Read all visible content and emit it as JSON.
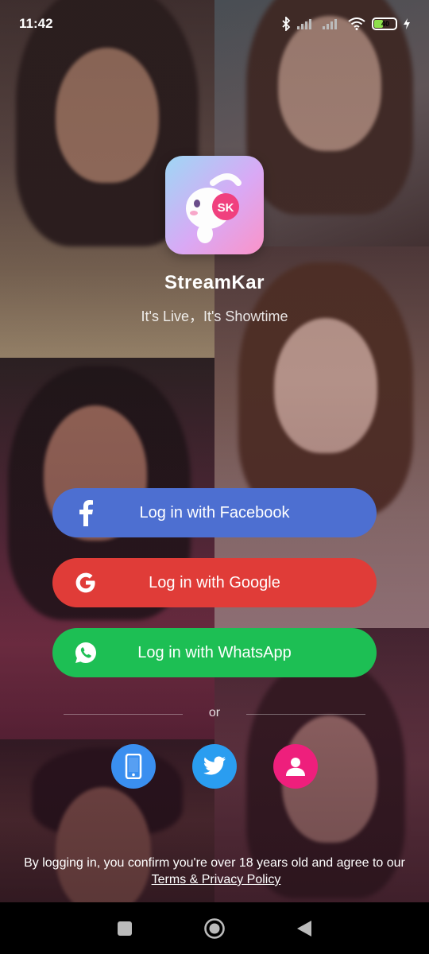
{
  "status_bar": {
    "time": "11:42",
    "battery_level": "40",
    "icons": [
      "bluetooth-icon",
      "signal-icon",
      "signal-icon",
      "wifi-icon",
      "battery-icon",
      "charging-icon"
    ]
  },
  "app": {
    "logo_text": "SK",
    "name": "StreamKar",
    "tagline": "It's Live，It's Showtime"
  },
  "login": {
    "facebook_label": "Log in with Facebook",
    "google_label": "Log in with Google",
    "whatsapp_label": "Log in with WhatsApp",
    "or_label": "or"
  },
  "alt_login": {
    "items": [
      "phone-icon",
      "twitter-icon",
      "profile-icon"
    ]
  },
  "legal": {
    "text": "By logging in, you confirm you're over 18 years old and agree to our",
    "link": "Terms & Privacy Policy"
  },
  "nav": {
    "items": [
      "recents-button",
      "home-button",
      "back-button"
    ]
  },
  "colors": {
    "facebook": "#4d6fd1",
    "google": "#e03c38",
    "whatsapp": "#1dbf54",
    "phone": "#3a8ff0",
    "twitter": "#2a9df0",
    "profile": "#ee1f7c"
  }
}
